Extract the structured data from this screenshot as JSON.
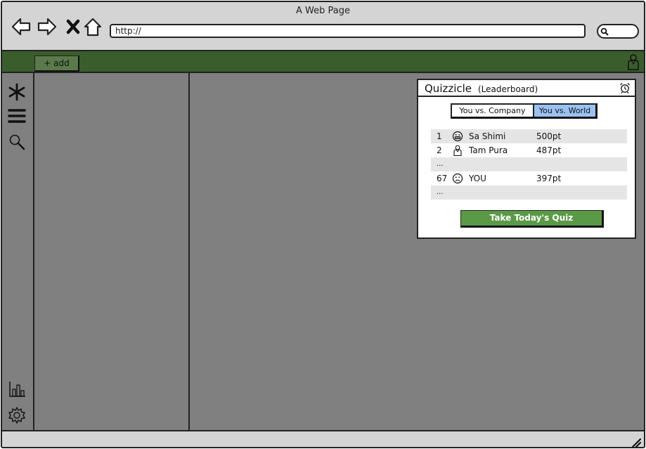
{
  "window": {
    "title": "A Web Page"
  },
  "toolbar": {
    "url": "http://",
    "icons": [
      "back-arrow-icon",
      "forward-arrow-icon",
      "close-icon",
      "home-icon",
      "search-icon"
    ]
  },
  "app_bar": {
    "add_label": "+ add",
    "user_icon": "user-icon",
    "color": "#3a5d2c"
  },
  "rail": {
    "icons": [
      "asterisk-icon",
      "menu-icon",
      "search-icon",
      "bar-chart-icon",
      "gear-icon"
    ]
  },
  "widget": {
    "title": "Quizzicle",
    "subtitle": "(Leaderboard)",
    "alarm_icon": "alarm-clock-icon",
    "tabs": [
      {
        "label": "You vs. Company",
        "selected": false
      },
      {
        "label": "You vs. World",
        "selected": true
      }
    ],
    "selected_tab_color": "#9ac1f2",
    "leaderboard": [
      {
        "rank": "1",
        "avatar": "grinning-face-icon",
        "name": "Sa Shimi",
        "points": "500pt"
      },
      {
        "rank": "2",
        "avatar": "user-icon",
        "name": "Tam Pura",
        "points": "487pt"
      },
      {
        "ellipsis": "..."
      },
      {
        "rank": "67",
        "avatar": "sad-face-icon",
        "name": "YOU",
        "points": "397pt"
      },
      {
        "ellipsis": "..."
      }
    ],
    "quiz_button": "Take Today's Quiz",
    "quiz_button_color": "#5a9a47"
  }
}
